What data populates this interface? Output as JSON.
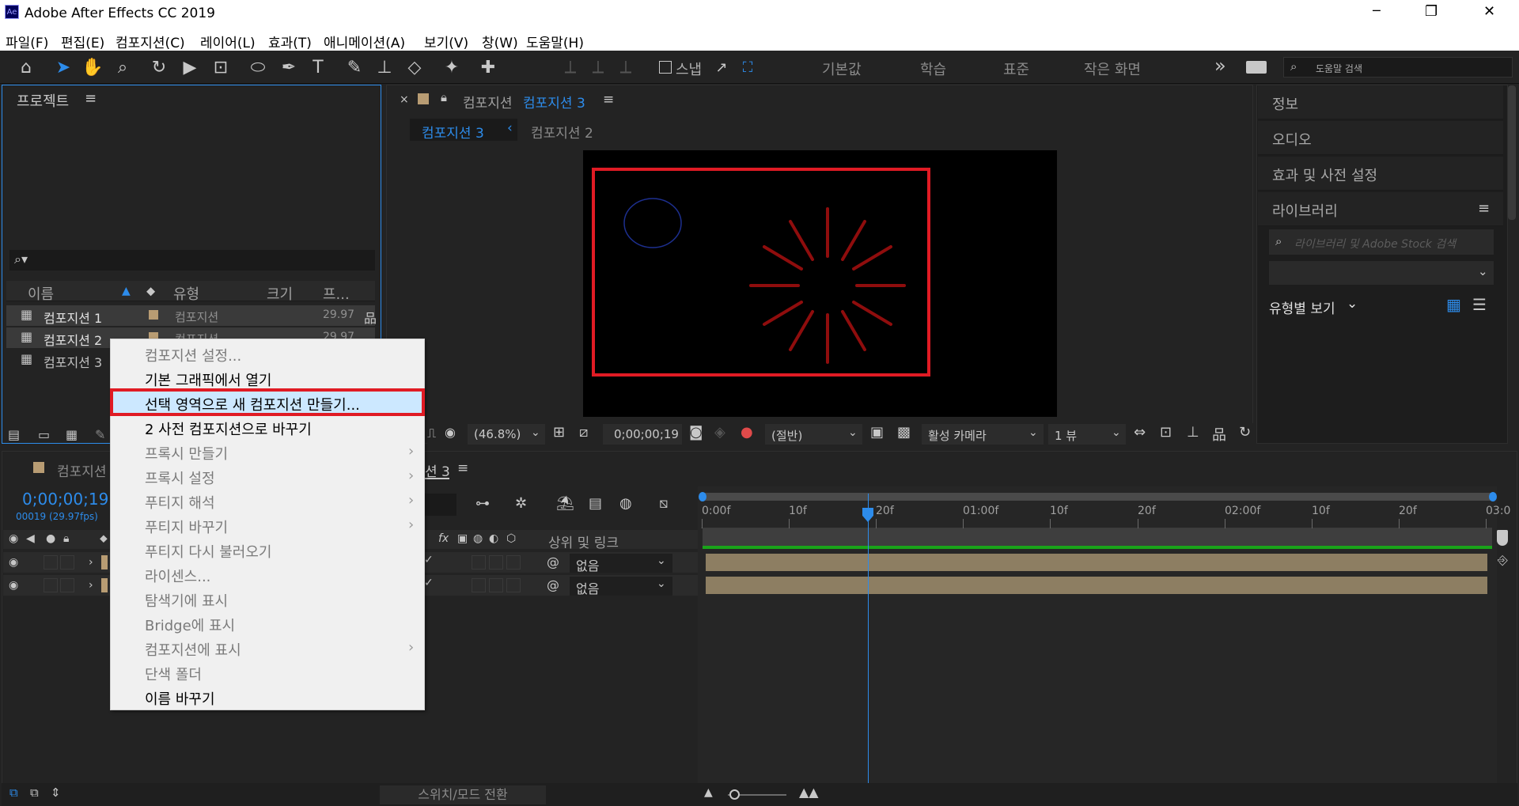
{
  "app": {
    "title": "Adobe After Effects CC 2019",
    "icon_label": "Ae"
  },
  "window_controls": {
    "minimize": "─",
    "maximize": "❐",
    "close": "✕"
  },
  "menu": [
    "파일(F)",
    "편집(E)",
    "컴포지션(C)",
    "레이어(L)",
    "효과(T)",
    "애니메이션(A)",
    "보기(V)",
    "창(W)",
    "도움말(H)"
  ],
  "toolbar": {
    "snap_label": "스냅",
    "workspaces": [
      "기본값",
      "학습",
      "표준",
      "작은 화면"
    ],
    "more": "»",
    "help_search_placeholder": "도움말 검색"
  },
  "project_panel": {
    "title": "프로젝트",
    "search_placeholder": "",
    "columns": [
      "이름",
      "유형",
      "크기",
      "프..."
    ],
    "items": [
      {
        "name": "컴포지션 1",
        "type": "컴포지션",
        "fps": "29.97"
      },
      {
        "name": "컴포지션 2",
        "type": "컴포지션",
        "fps": "29.97"
      },
      {
        "name": "컴포지션 3",
        "type": "",
        "fps": ""
      }
    ]
  },
  "context_menu": {
    "items": [
      {
        "label": "컴포지션 설정...",
        "enabled": false,
        "submenu": false
      },
      {
        "label": "기본 그래픽에서 열기",
        "enabled": true,
        "submenu": false
      },
      {
        "label": "선택 영역으로 새 컴포지션 만들기...",
        "enabled": true,
        "submenu": false,
        "highlighted": true
      },
      {
        "label": "2 사전 컴포지션으로 바꾸기",
        "enabled": true,
        "submenu": false
      },
      {
        "label": "프록시 만들기",
        "enabled": false,
        "submenu": true
      },
      {
        "label": "프록시 설정",
        "enabled": false,
        "submenu": true
      },
      {
        "label": "푸티지 해석",
        "enabled": false,
        "submenu": true
      },
      {
        "label": "푸티지 바꾸기",
        "enabled": false,
        "submenu": true
      },
      {
        "label": "푸티지 다시 불러오기",
        "enabled": false,
        "submenu": false
      },
      {
        "label": "라이센스...",
        "enabled": false,
        "submenu": false
      },
      {
        "label": "탐색기에 표시",
        "enabled": false,
        "submenu": false
      },
      {
        "label": "Bridge에 표시",
        "enabled": false,
        "submenu": false
      },
      {
        "label": "컴포지션에 표시",
        "enabled": false,
        "submenu": true
      },
      {
        "label": "단색 폴더",
        "enabled": false,
        "submenu": false
      },
      {
        "label": "이름 바꾸기",
        "enabled": true,
        "submenu": false
      }
    ]
  },
  "comp_viewer": {
    "panel_title_prefix": "컴포지션",
    "panel_title_name": "컴포지션 3",
    "breadcrumbs": [
      "컴포지션 3",
      "컴포지션 2"
    ],
    "zoom": "(46.8%)",
    "timecode": "0;00;00;19",
    "resolution": "(절반)",
    "camera": "활성 카메라",
    "views": "1 뷰"
  },
  "right_panels": {
    "info": "정보",
    "audio": "오디오",
    "effects": "효과 및 사전 설정",
    "libraries": "라이브러리",
    "library_search_placeholder": "라이브러리 및 Adobe Stock 검색",
    "view_by_type": "유형별 보기"
  },
  "timeline": {
    "comp_tab": "컴포지션 3",
    "tab_prefix": "컴포지션",
    "tab_suffix": "션 3",
    "current_time": "0;00;00;19",
    "frame_info": "00019 (29.97fps)",
    "parent_header": "상위 및 링크",
    "layers": [
      {
        "parent": "없음"
      },
      {
        "parent": "없음"
      }
    ],
    "ruler_labels": [
      "0:00f",
      "10f",
      "20f",
      "01:00f",
      "10f",
      "20f",
      "02:00f",
      "10f",
      "20f",
      "03:0"
    ],
    "switch_mode_label": "스위치/모드 전환",
    "playhead_fraction": 0.2
  },
  "colors": {
    "accent_blue": "#2d8ceb",
    "highlight_red": "#e01b24",
    "clip_tan": "#8d7e62",
    "burst_red": "#8f0d0d"
  }
}
